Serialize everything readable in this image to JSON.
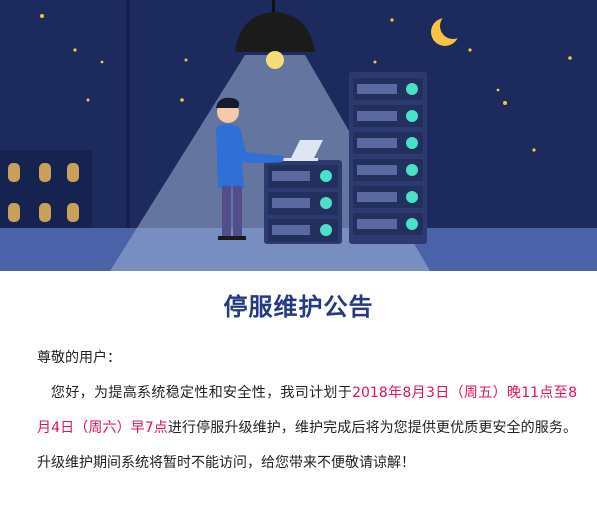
{
  "banner": {
    "colors": {
      "sky": "#1d2a5e",
      "floor": "#4a62a8",
      "light_beam": "#9fb2d6",
      "lamp": "#1b1b1b",
      "server": "#2c3a70",
      "server_led": "#4be0c8",
      "moon": "#f6c343",
      "star": "#f6c343"
    }
  },
  "notice": {
    "title": "停服维护公告",
    "greeting": "尊敬的用户：",
    "text_before": "您好，为提高系统稳定性和安全性，我司计划于",
    "time_window": "2018年8月3日（周五）晚11点至8月4日（周六）早7点",
    "text_after": "进行停服升级维护，维护完成后将为您提供更优质更安全的服务。升级维护期间系统将暂时不能访问，给您带来不便敬请谅解！",
    "highlight_color": "#e0115f",
    "title_color": "#253a82"
  }
}
